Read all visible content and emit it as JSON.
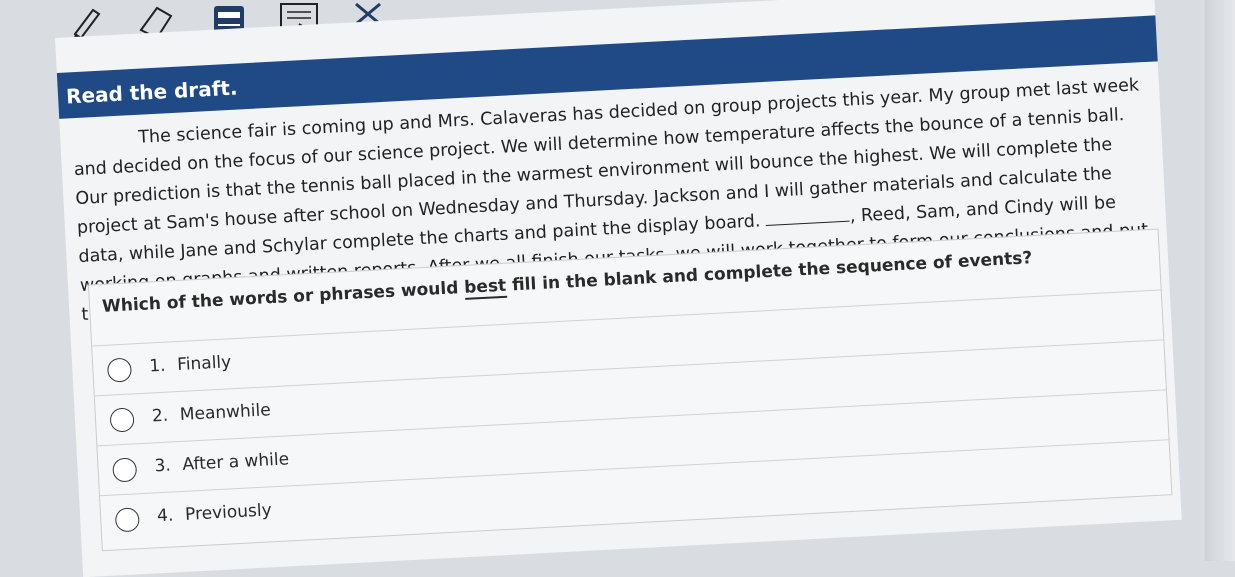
{
  "toolbar": {
    "tools": [
      {
        "icon": "pencil-icon"
      },
      {
        "icon": "eraser-icon"
      },
      {
        "icon": "calculator-icon"
      },
      {
        "icon": "notepad-icon"
      },
      {
        "icon": "eliminator-icon"
      }
    ]
  },
  "passage": {
    "header": "Read the draft.",
    "text_before_blank": "The science fair is coming up and Mrs. Calaveras has decided on group projects this year. My group met last week and decided on the focus of our science project. We will determine how temperature affects the bounce of a tennis ball. Our prediction is that the tennis ball placed in the warmest environment will bounce the highest. We will complete the project at Sam's house after school on Wednesday and Thursday. Jackson and I will gather materials and calculate the data, while Jane and Schylar complete the charts and paint the display board.",
    "text_after_blank": ", Reed, Sam, and Cindy will be working on graphs and written reports. After we all finish our tasks, we will work together to form our conclusions and put the project together."
  },
  "question": {
    "prefix": "Which of the words or phrases would ",
    "emphasis": "best",
    "suffix": " fill in the blank and complete the sequence of events?"
  },
  "options": [
    {
      "number": "1.",
      "label": "Finally"
    },
    {
      "number": "2.",
      "label": "Meanwhile"
    },
    {
      "number": "3.",
      "label": "After a while"
    },
    {
      "number": "4.",
      "label": "Previously"
    }
  ],
  "colors": {
    "banner": "#1f4a86",
    "banner_text": "#ffffff",
    "page_bg": "#f3f4f6"
  }
}
